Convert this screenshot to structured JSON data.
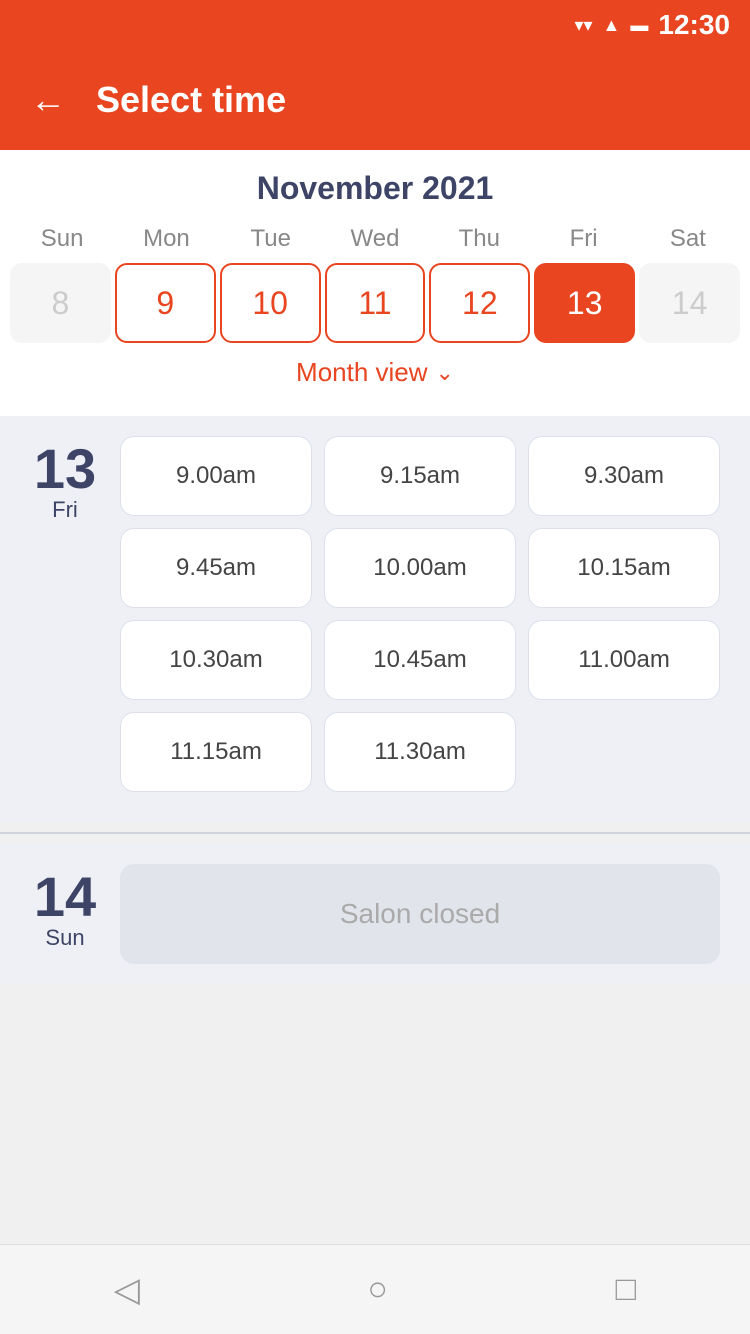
{
  "statusBar": {
    "time": "12:30",
    "wifiIcon": "▼",
    "signalIcon": "▲",
    "batteryIcon": "▬"
  },
  "topBar": {
    "backLabel": "←",
    "title": "Select time"
  },
  "calendar": {
    "monthYear": "November 2021",
    "dayHeaders": [
      "Sun",
      "Mon",
      "Tue",
      "Wed",
      "Thu",
      "Fri",
      "Sat"
    ],
    "dates": [
      {
        "value": "8",
        "state": "inactive"
      },
      {
        "value": "9",
        "state": "active"
      },
      {
        "value": "10",
        "state": "active"
      },
      {
        "value": "11",
        "state": "active"
      },
      {
        "value": "12",
        "state": "active"
      },
      {
        "value": "13",
        "state": "selected"
      },
      {
        "value": "14",
        "state": "inactive-right"
      }
    ],
    "monthViewLabel": "Month view"
  },
  "daySlots": [
    {
      "dayNumber": "13",
      "dayName": "Fri",
      "slots": [
        "9.00am",
        "9.15am",
        "9.30am",
        "9.45am",
        "10.00am",
        "10.15am",
        "10.30am",
        "10.45am",
        "11.00am",
        "11.15am",
        "11.30am"
      ]
    }
  ],
  "closedDay": {
    "dayNumber": "14",
    "dayName": "Sun",
    "message": "Salon closed"
  },
  "bottomNav": {
    "backIcon": "◁",
    "homeIcon": "○",
    "recentIcon": "□"
  }
}
